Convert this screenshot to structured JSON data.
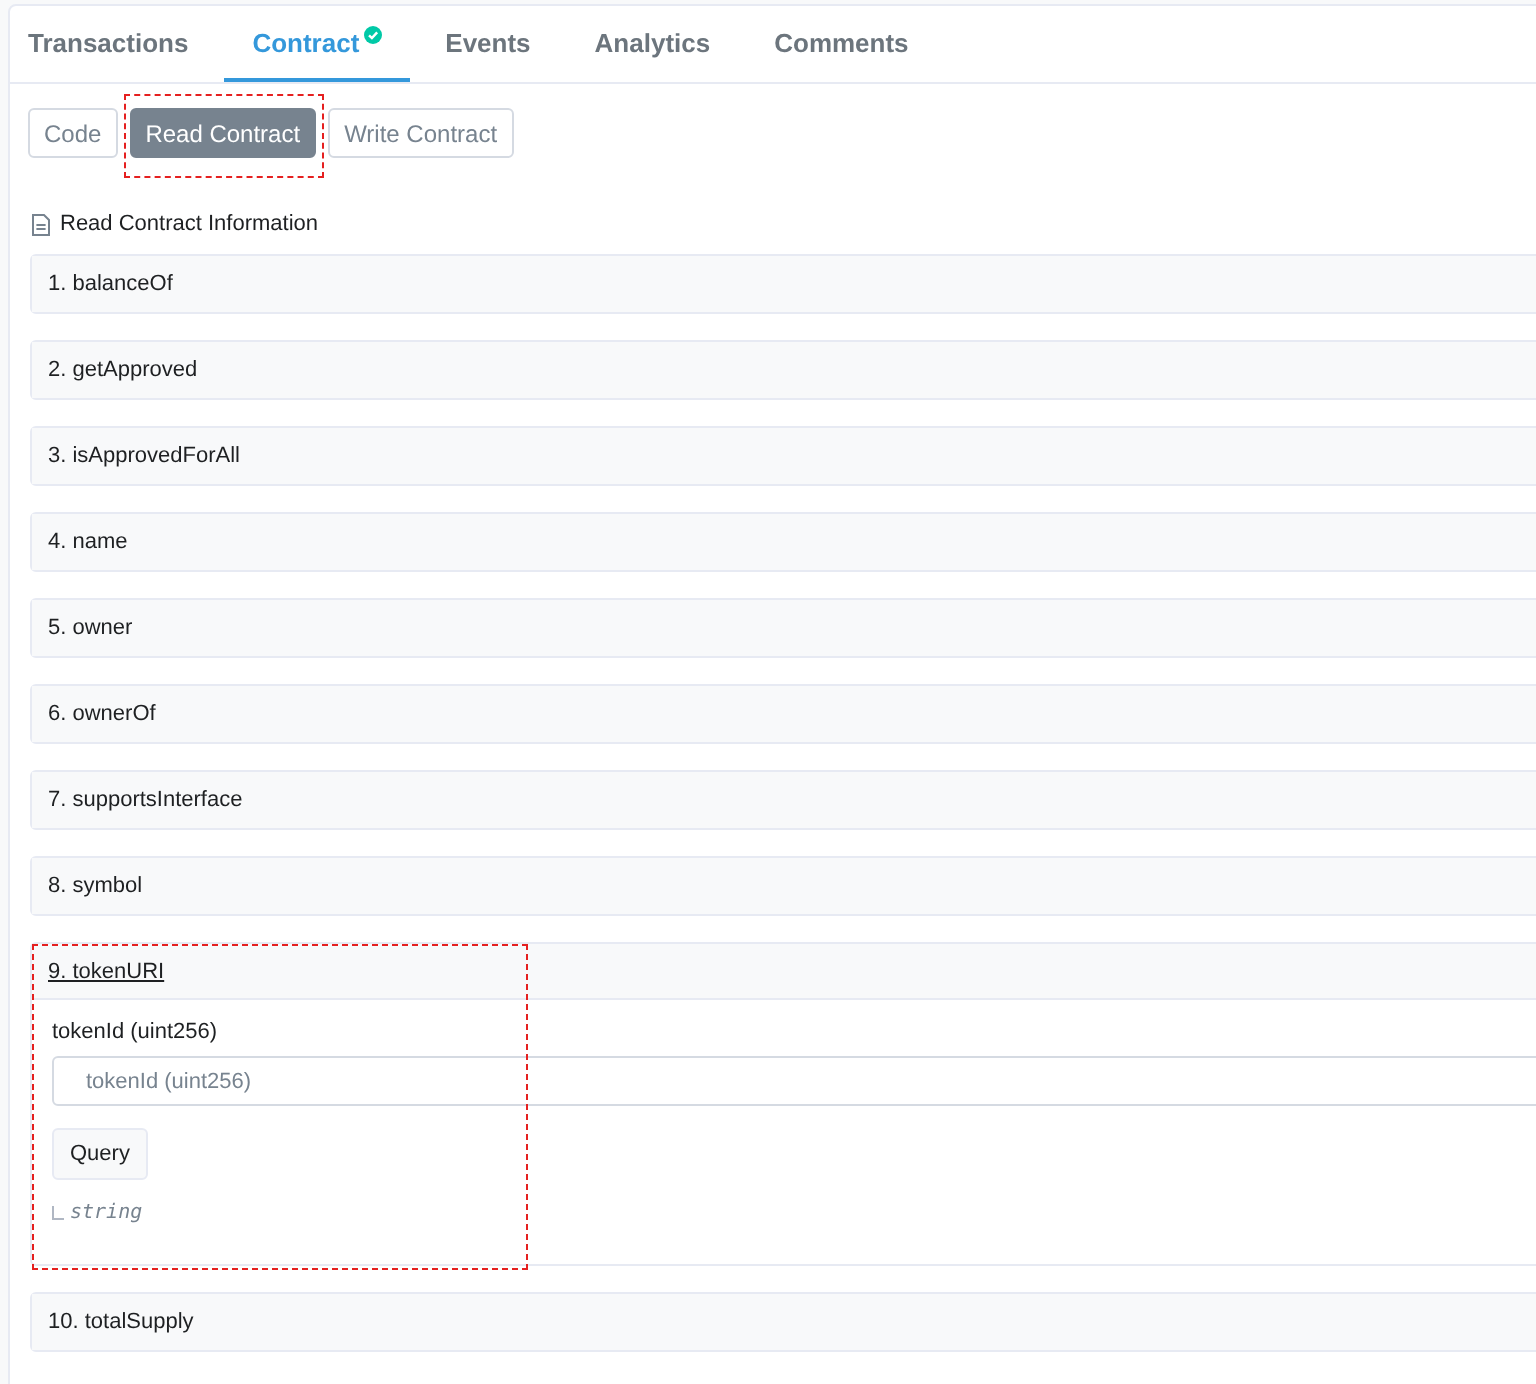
{
  "tabs": [
    {
      "label": "Transactions",
      "selected": false,
      "verified": false
    },
    {
      "label": "Contract",
      "selected": true,
      "verified": true
    },
    {
      "label": "Events",
      "selected": false,
      "verified": false
    },
    {
      "label": "Analytics",
      "selected": false,
      "verified": false
    },
    {
      "label": "Comments",
      "selected": false,
      "verified": false
    }
  ],
  "subtabs": [
    {
      "label": "Code",
      "selected": false,
      "highlighted": false
    },
    {
      "label": "Read Contract",
      "selected": true,
      "highlighted": true
    },
    {
      "label": "Write Contract",
      "selected": false,
      "highlighted": false
    }
  ],
  "section_title": "Read Contract Information",
  "functions": [
    {
      "title": "1. balanceOf",
      "expanded": false,
      "highlighted": false
    },
    {
      "title": "2. getApproved",
      "expanded": false,
      "highlighted": false
    },
    {
      "title": "3. isApprovedForAll",
      "expanded": false,
      "highlighted": false
    },
    {
      "title": "4. name",
      "expanded": false,
      "highlighted": false
    },
    {
      "title": "5. owner",
      "expanded": false,
      "highlighted": false
    },
    {
      "title": "6. ownerOf",
      "expanded": false,
      "highlighted": false
    },
    {
      "title": "7. supportsInterface",
      "expanded": false,
      "highlighted": false
    },
    {
      "title": "8. symbol",
      "expanded": false,
      "highlighted": false
    },
    {
      "title": "9. tokenURI",
      "expanded": true,
      "highlighted": true,
      "input_label": "tokenId (uint256)",
      "placeholder": "tokenId (uint256)",
      "button": "Query",
      "output_type": "string"
    },
    {
      "title": "10. totalSupply",
      "expanded": false,
      "highlighted": false
    }
  ]
}
